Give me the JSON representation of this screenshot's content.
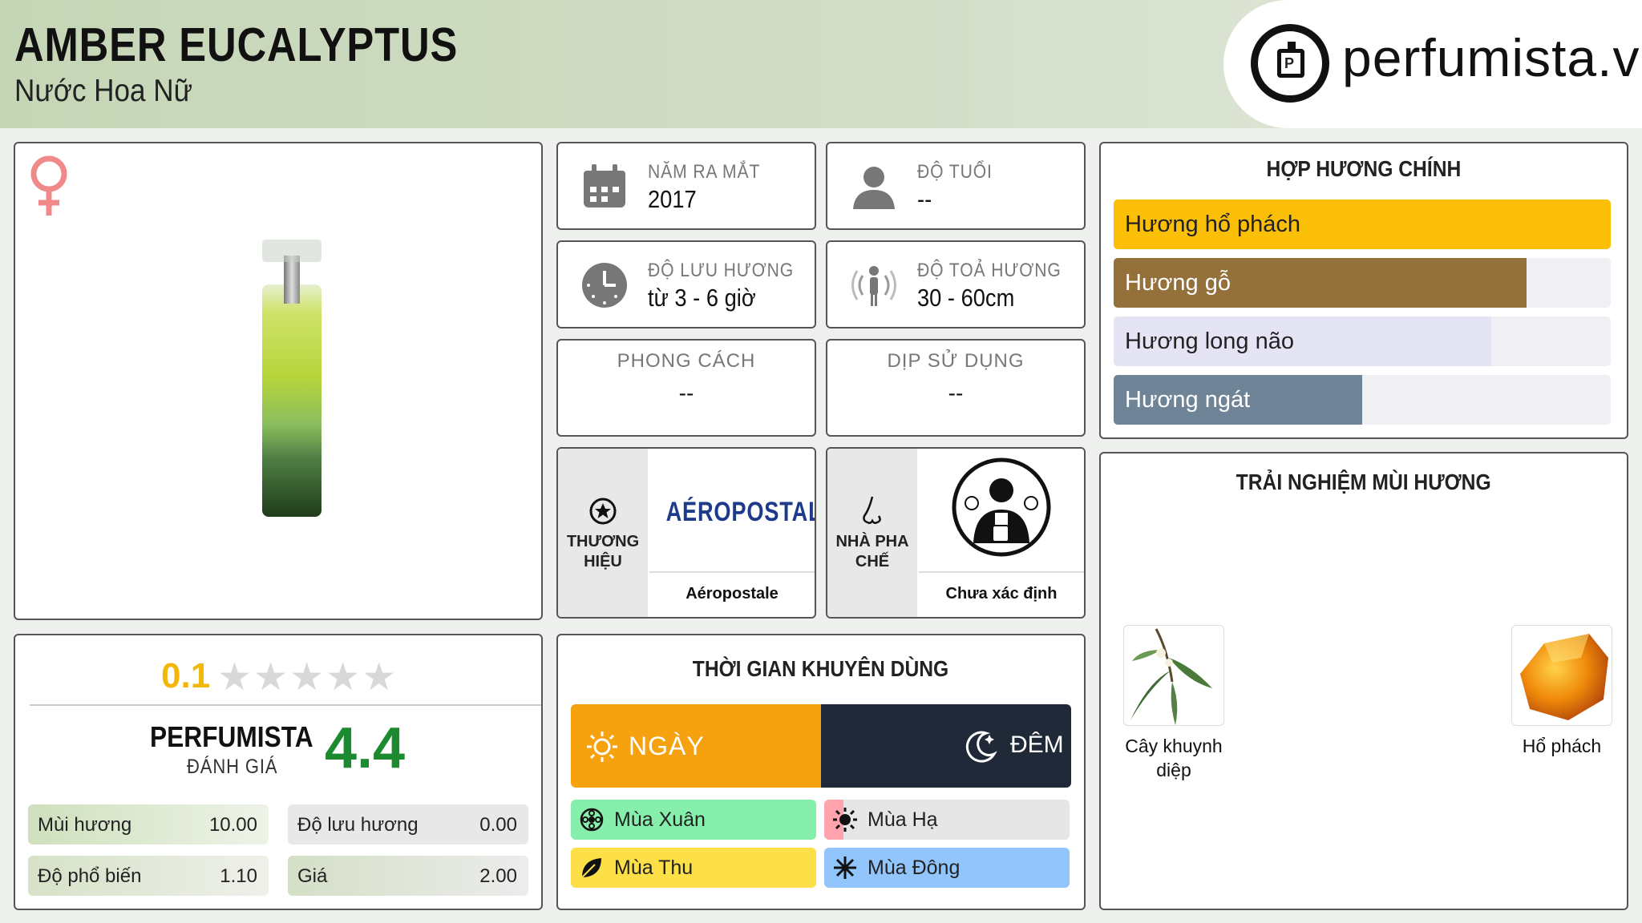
{
  "header": {
    "title": "AMBER EUCALYPTUS",
    "subtitle": "Nước Hoa Nữ",
    "logo_text": "perfumista.vn",
    "logo_mark": "P"
  },
  "info": {
    "launch": {
      "label": "NĂM RA MẮT",
      "value": "2017"
    },
    "age": {
      "label": "ĐỘ TUỔI",
      "value": "--"
    },
    "longevity": {
      "label": "ĐỘ LƯU HƯƠNG",
      "value": "từ 3 - 6 giờ"
    },
    "sillage": {
      "label": "ĐỘ TOẢ HƯƠNG",
      "value": "30 - 60cm"
    },
    "style": {
      "label": "PHONG CÁCH",
      "value": "--"
    },
    "occasion": {
      "label": "DỊP SỬ DỤNG",
      "value": "--"
    }
  },
  "brand": {
    "label_line1": "THƯƠNG",
    "label_line2": "HIỆU",
    "logo_text": "AÉROPOSTALE",
    "name": "Aéropostale"
  },
  "perfumer": {
    "label_line1": "NHÀ PHA",
    "label_line2": "CHẾ",
    "name": "Chưa xác định"
  },
  "accords": {
    "title": "HỢP HƯƠNG CHÍNH",
    "items": [
      {
        "label": "Hương hổ phách",
        "level": 100,
        "color": "#fbbf07",
        "text_color": "#222222"
      },
      {
        "label": "Hương gỗ",
        "level": 83,
        "color": "#94703a",
        "text_color": "#ffffff"
      },
      {
        "label": "Hương long não",
        "level": 76,
        "color": "#e4e4f4",
        "text_color": "#222222"
      },
      {
        "label": "Hương ngát",
        "level": 50,
        "color": "#6f8497",
        "text_color": "#ffffff"
      }
    ]
  },
  "notes": {
    "title": "TRẢI NGHIỆM MÙI HƯƠNG",
    "items": [
      {
        "label_line1": "Cây khuynh",
        "label_line2": "diệp"
      },
      {
        "label_line1": "Hổ phách",
        "label_line2": ""
      }
    ]
  },
  "rating": {
    "user_score": "0.1",
    "stars_max": 5,
    "perfumista_label": "PERFUMISTA",
    "perfumista_sub": "ĐÁNH GIÁ",
    "perfumista_score": "4.4",
    "metrics": [
      {
        "label": "Mùi hương",
        "value": "10.00"
      },
      {
        "label": "Độ lưu hương",
        "value": "0.00"
      },
      {
        "label": "Độ phổ biến",
        "value": "1.10"
      },
      {
        "label": "Giá",
        "value": "2.00"
      }
    ]
  },
  "usage": {
    "title": "THỜI GIAN KHUYÊN DÙNG",
    "day_label": "NGÀY",
    "night_label": "ĐÊM",
    "day_color": "#f6a10e",
    "night_color": "#1f2937",
    "seasons": [
      {
        "label": "Mùa Xuân",
        "level": 100,
        "color": "#86efac"
      },
      {
        "label": "Mùa Hạ",
        "level": 8,
        "color": "#fda4af"
      },
      {
        "label": "Mùa Thu",
        "level": 100,
        "color": "#fde047"
      },
      {
        "label": "Mùa Đông",
        "level": 100,
        "color": "#93c5fd"
      }
    ]
  }
}
